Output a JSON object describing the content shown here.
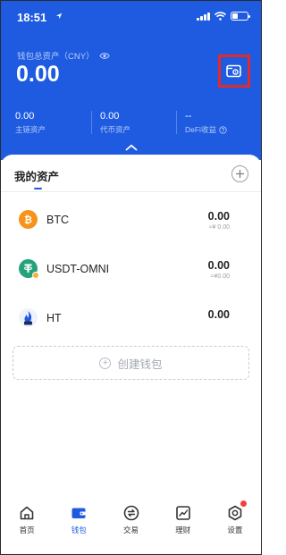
{
  "status_bar": {
    "time": "18:51"
  },
  "header": {
    "total_assets_label": "钱包总资产（CNY）",
    "total_assets_value": "0.00",
    "stats": [
      {
        "value": "0.00",
        "label": "主链资产"
      },
      {
        "value": "0.00",
        "label": "代币资产"
      },
      {
        "value": "--",
        "label": "DeFi收益"
      }
    ]
  },
  "assets_card": {
    "title": "我的资产",
    "items": [
      {
        "symbol": "BTC",
        "amount": "0.00",
        "fiat": "≈¥ 0.00",
        "icon": "bitcoin-icon"
      },
      {
        "symbol": "USDT-OMNI",
        "amount": "0.00",
        "fiat": "≈¥0.00",
        "icon": "tether-icon"
      },
      {
        "symbol": "HT",
        "amount": "0.00",
        "fiat": "",
        "icon": "huobi-token-icon"
      }
    ],
    "create_wallet_label": "创建钱包"
  },
  "tabbar": {
    "items": [
      {
        "label": "首页",
        "icon": "home-icon"
      },
      {
        "label": "钱包",
        "icon": "wallet-icon",
        "active": true
      },
      {
        "label": "交易",
        "icon": "exchange-icon"
      },
      {
        "label": "理财",
        "icon": "chart-icon"
      },
      {
        "label": "设置",
        "icon": "settings-icon"
      }
    ]
  },
  "colors": {
    "primary": "#1e5be0",
    "highlight_box": "#e22a2a",
    "bitcoin": "#f7931a",
    "tether": "#26a17b",
    "notification": "#f0413d"
  }
}
